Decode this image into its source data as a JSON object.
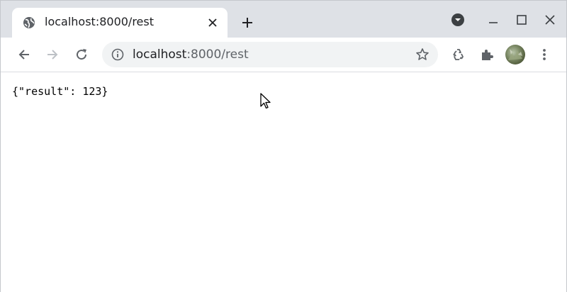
{
  "tab": {
    "title": "localhost:8000/rest",
    "favicon": "globe-icon"
  },
  "address_bar": {
    "host": "localhost",
    "path": ":8000/rest",
    "info_icon": "info-icon"
  },
  "toolbar": {
    "icons": [
      "back-icon",
      "forward-icon",
      "reload-icon",
      "star-icon",
      "recycle-icon",
      "extensions-icon",
      "avatar",
      "menu-icon"
    ]
  },
  "page": {
    "body_text": "{\"result\": 123}"
  },
  "colors": {
    "frame": "#dee1e6",
    "tab_active": "#ffffff",
    "omnibox": "#f1f3f4",
    "icon": "#5f6368"
  }
}
